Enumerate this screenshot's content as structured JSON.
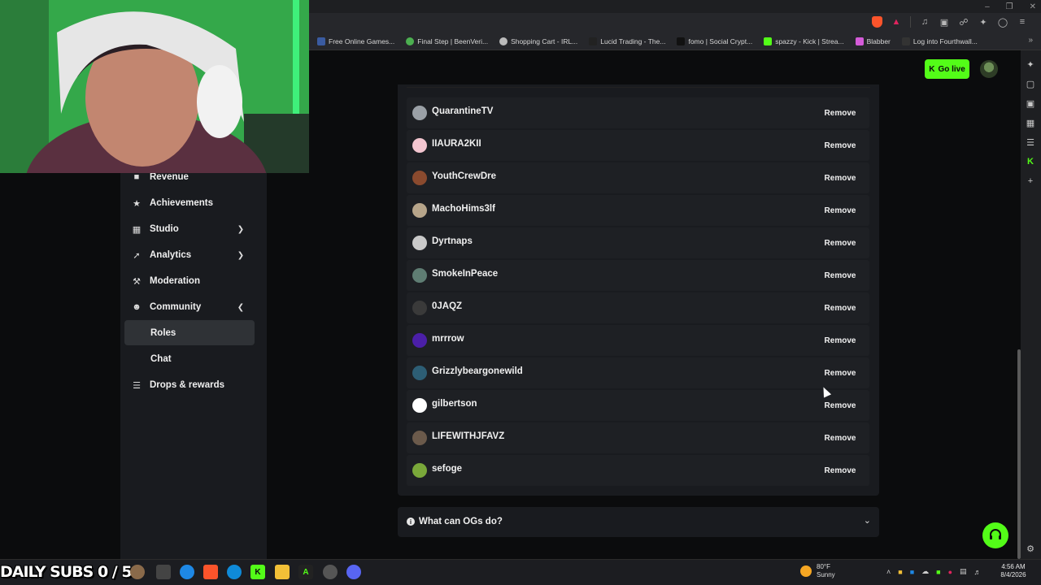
{
  "bookmarks": [
    {
      "label": "Free Online Games...",
      "color": "#3a5ba0"
    },
    {
      "label": "Final Step | BeenVeri...",
      "color": "#4caf50"
    },
    {
      "label": "Shopping Cart - IRL...",
      "color": "#bbbbbb"
    },
    {
      "label": "Lucid Trading - The...",
      "color": "#222222"
    },
    {
      "label": "fomo | Social Crypt...",
      "color": "#111111"
    },
    {
      "label": "spazzy - Kick | Strea...",
      "color": "#53fc18"
    },
    {
      "label": "Blabber",
      "color": "#d45bd8"
    },
    {
      "label": "Log into Fourthwall...",
      "color": "#333333"
    }
  ],
  "header": {
    "go_live_label": "Go live"
  },
  "nav": {
    "revenue": "Revenue",
    "achievements": "Achievements",
    "studio": "Studio",
    "analytics": "Analytics",
    "moderation": "Moderation",
    "community": "Community",
    "roles": "Roles",
    "chat": "Chat",
    "drops": "Drops & rewards"
  },
  "og_list": {
    "remove_label": "Remove",
    "users": [
      {
        "name": "QuarantineTV",
        "avatar_color": "#9aa0a6"
      },
      {
        "name": "IIAURA2KII",
        "avatar_color": "#f3c6d0"
      },
      {
        "name": "YouthCrewDre",
        "avatar_color": "#8a4a2e"
      },
      {
        "name": "MachoHims3lf",
        "avatar_color": "#b7a58a"
      },
      {
        "name": "Dyrtnaps",
        "avatar_color": "#c9c9c9"
      },
      {
        "name": "SmokeInPeace",
        "avatar_color": "#5f7d73"
      },
      {
        "name": "0JAQZ",
        "avatar_color": "#3a3a3a"
      },
      {
        "name": "mrrrow",
        "avatar_color": "#4b1fa8"
      },
      {
        "name": "Grizzlybeargonewild",
        "avatar_color": "#2d5e75"
      },
      {
        "name": "gilbertson",
        "avatar_color": "#ffffff"
      },
      {
        "name": "LIFEWITHJFAVZ",
        "avatar_color": "#6b5a4b"
      },
      {
        "name": "sefoge",
        "avatar_color": "#7aa83a"
      }
    ]
  },
  "faq": {
    "question": "What can OGs do?"
  },
  "overlay": {
    "daily_subs": "DAILY SUBS 0 / 5"
  },
  "taskbar": {
    "temperature": "80°F",
    "condition": "Sunny",
    "time": "4:56 AM",
    "date": "8/4/2026"
  },
  "colors": {
    "accent": "#53fc18",
    "surface": "#191b1f",
    "row": "#1e2024",
    "background": "#0b0c0d"
  }
}
